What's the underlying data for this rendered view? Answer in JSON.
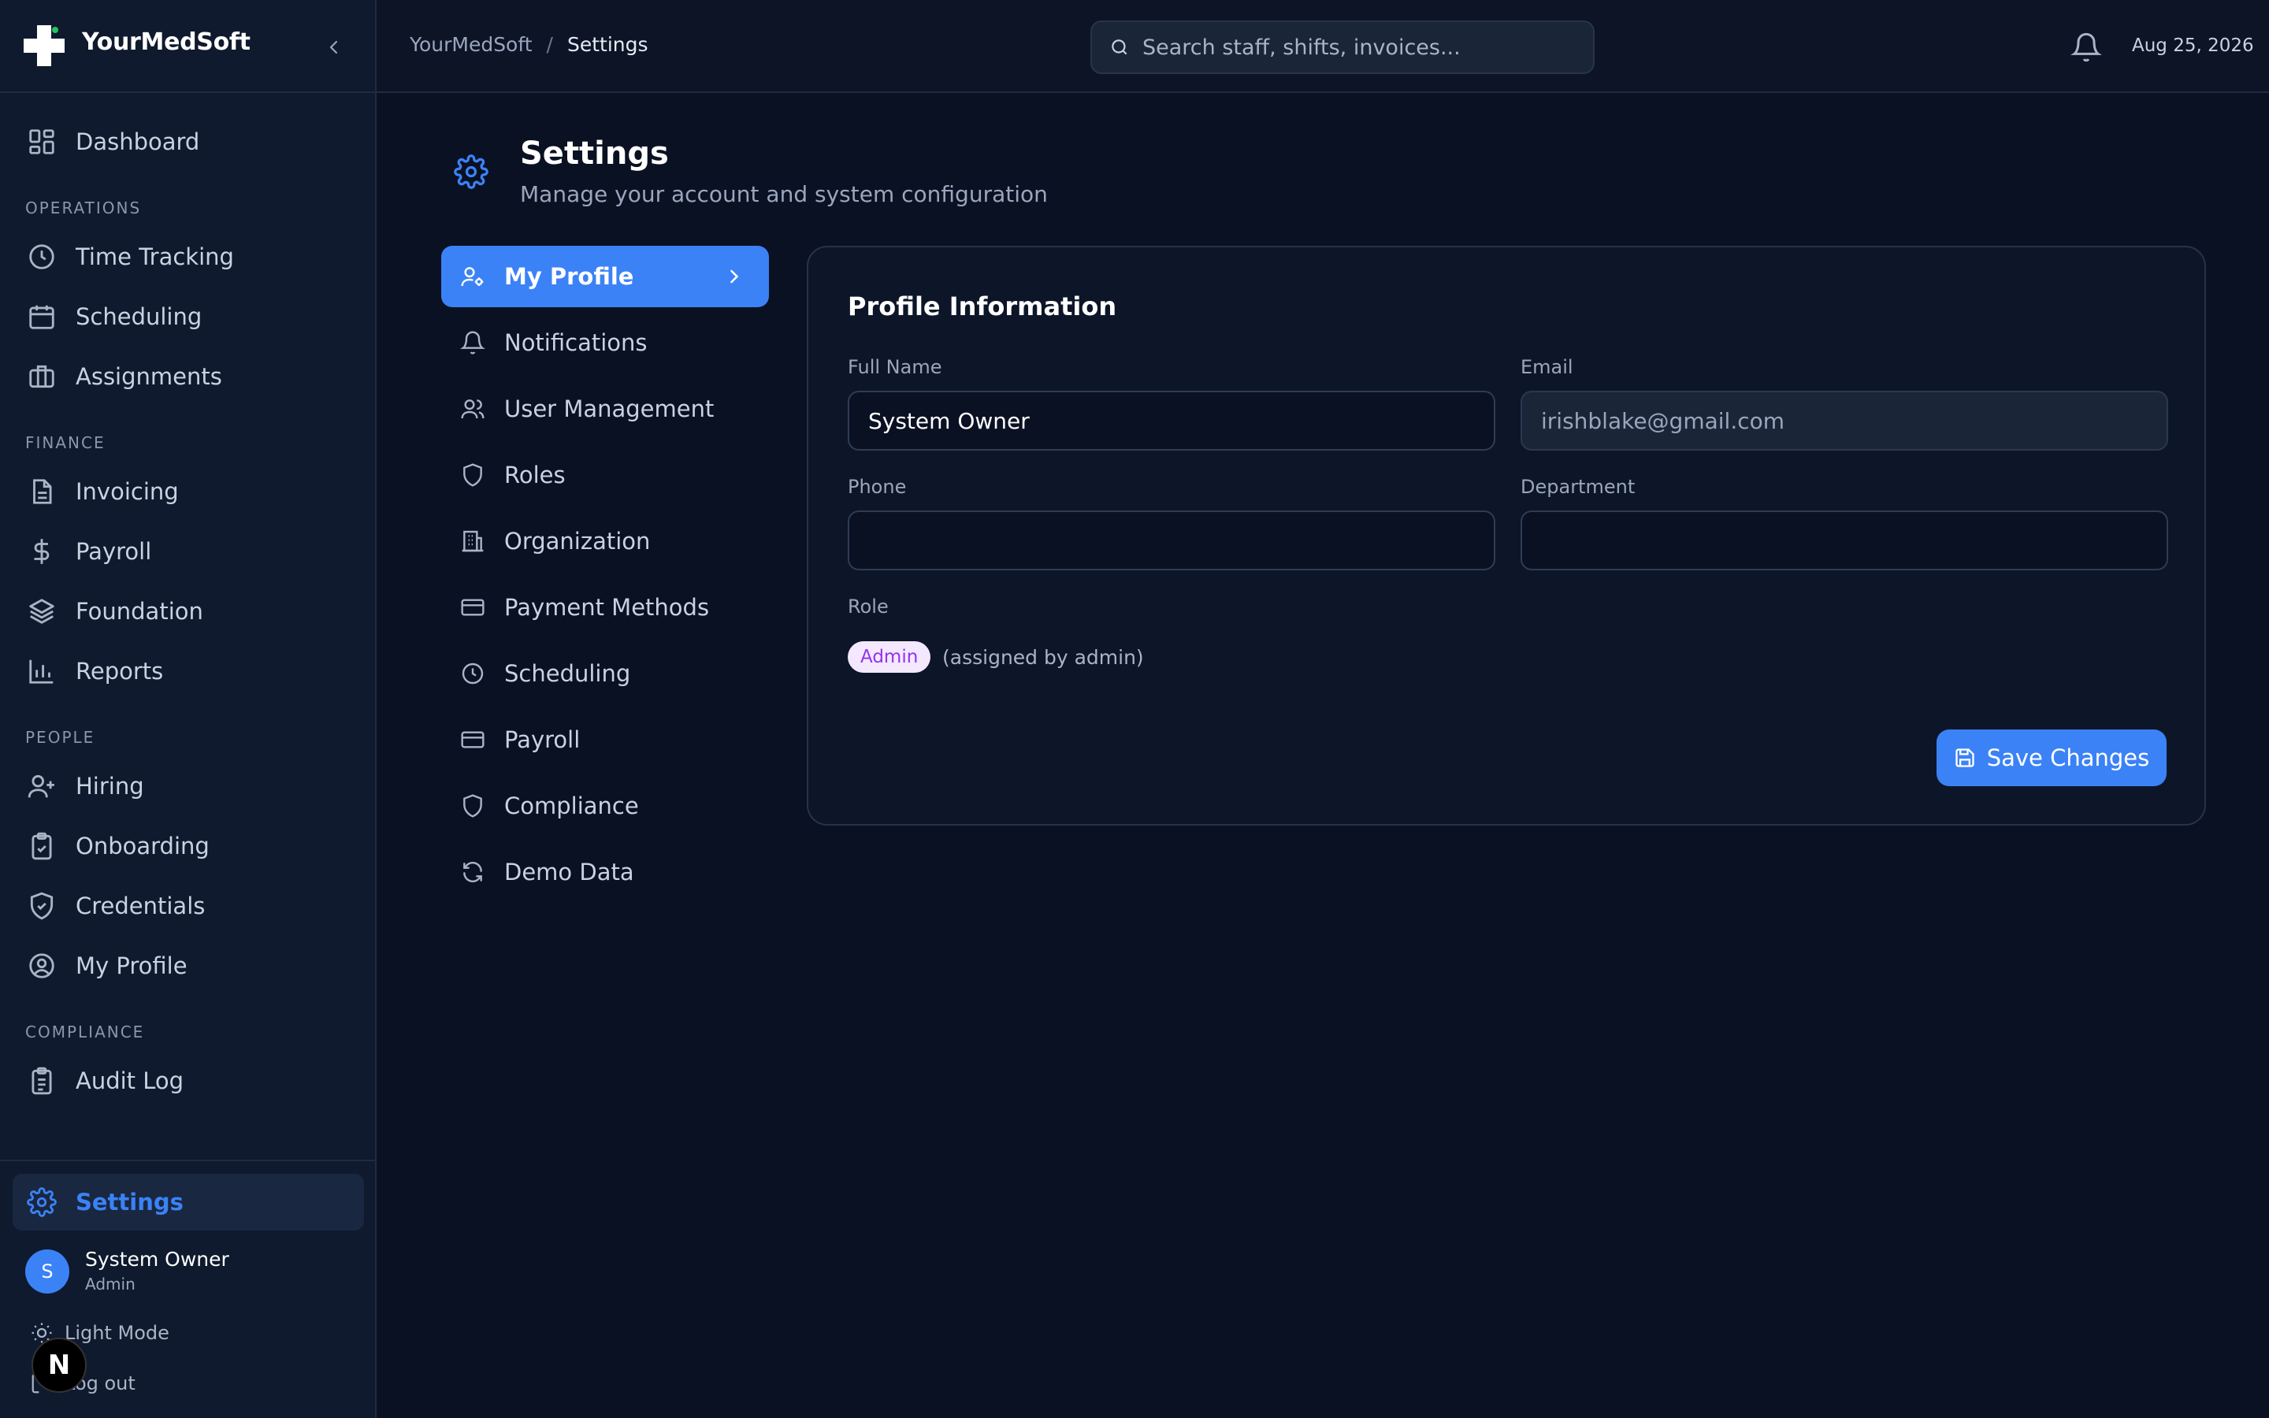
{
  "app": {
    "name": "YourMedSoft"
  },
  "sidebar": {
    "top_item": {
      "label": "Dashboard",
      "icon": "dashboard-icon"
    },
    "sections": [
      {
        "title": "OPERATIONS",
        "items": [
          {
            "label": "Time Tracking",
            "icon": "clock-icon"
          },
          {
            "label": "Scheduling",
            "icon": "calendar-icon"
          },
          {
            "label": "Assignments",
            "icon": "briefcase-icon"
          }
        ]
      },
      {
        "title": "FINANCE",
        "items": [
          {
            "label": "Invoicing",
            "icon": "file-text-icon"
          },
          {
            "label": "Payroll",
            "icon": "dollar-icon"
          },
          {
            "label": "Foundation",
            "icon": "layers-icon"
          },
          {
            "label": "Reports",
            "icon": "bar-chart-icon"
          }
        ]
      },
      {
        "title": "PEOPLE",
        "items": [
          {
            "label": "Hiring",
            "icon": "user-plus-icon"
          },
          {
            "label": "Onboarding",
            "icon": "clipboard-check-icon"
          },
          {
            "label": "Credentials",
            "icon": "shield-check-icon"
          },
          {
            "label": "My Profile",
            "icon": "user-circle-icon"
          }
        ]
      },
      {
        "title": "COMPLIANCE",
        "items": [
          {
            "label": "Audit Log",
            "icon": "clipboard-list-icon"
          }
        ]
      }
    ],
    "settings_label": "Settings",
    "user": {
      "initial": "S",
      "name": "System Owner",
      "role": "Admin"
    },
    "light_mode_label": "Light Mode",
    "logout_label": "Log out",
    "dev_badge": "N"
  },
  "topbar": {
    "breadcrumb": [
      "YourMedSoft",
      "Settings"
    ],
    "breadcrumb_sep": "/",
    "search_placeholder": "Search staff, shifts, invoices...",
    "date": "Aug 25, 2026"
  },
  "page": {
    "title": "Settings",
    "subtitle": "Manage your account and system configuration"
  },
  "settings_menu": [
    {
      "label": "My Profile",
      "icon": "user-cog-icon",
      "active": true
    },
    {
      "label": "Notifications",
      "icon": "bell-icon"
    },
    {
      "label": "User Management",
      "icon": "users-icon"
    },
    {
      "label": "Roles",
      "icon": "shield-icon"
    },
    {
      "label": "Organization",
      "icon": "building-icon"
    },
    {
      "label": "Payment Methods",
      "icon": "credit-card-icon"
    },
    {
      "label": "Scheduling",
      "icon": "clock-icon"
    },
    {
      "label": "Payroll",
      "icon": "credit-card-icon"
    },
    {
      "label": "Compliance",
      "icon": "shield-icon"
    },
    {
      "label": "Demo Data",
      "icon": "refresh-icon"
    }
  ],
  "profile": {
    "title": "Profile Information",
    "full_name_label": "Full Name",
    "full_name_value": "System Owner",
    "email_label": "Email",
    "email_value": "irishblake@gmail.com",
    "phone_label": "Phone",
    "phone_value": "",
    "department_label": "Department",
    "department_value": "",
    "role_label": "Role",
    "role_value": "Admin",
    "role_note": "(assigned by admin)",
    "save_label": "Save Changes"
  },
  "colors": {
    "accent": "#3b82f6",
    "background": "#0a1122",
    "sidebar": "#0f1a2e",
    "role_pill_bg": "#f3e8ff",
    "role_pill_text": "#9333ea"
  }
}
